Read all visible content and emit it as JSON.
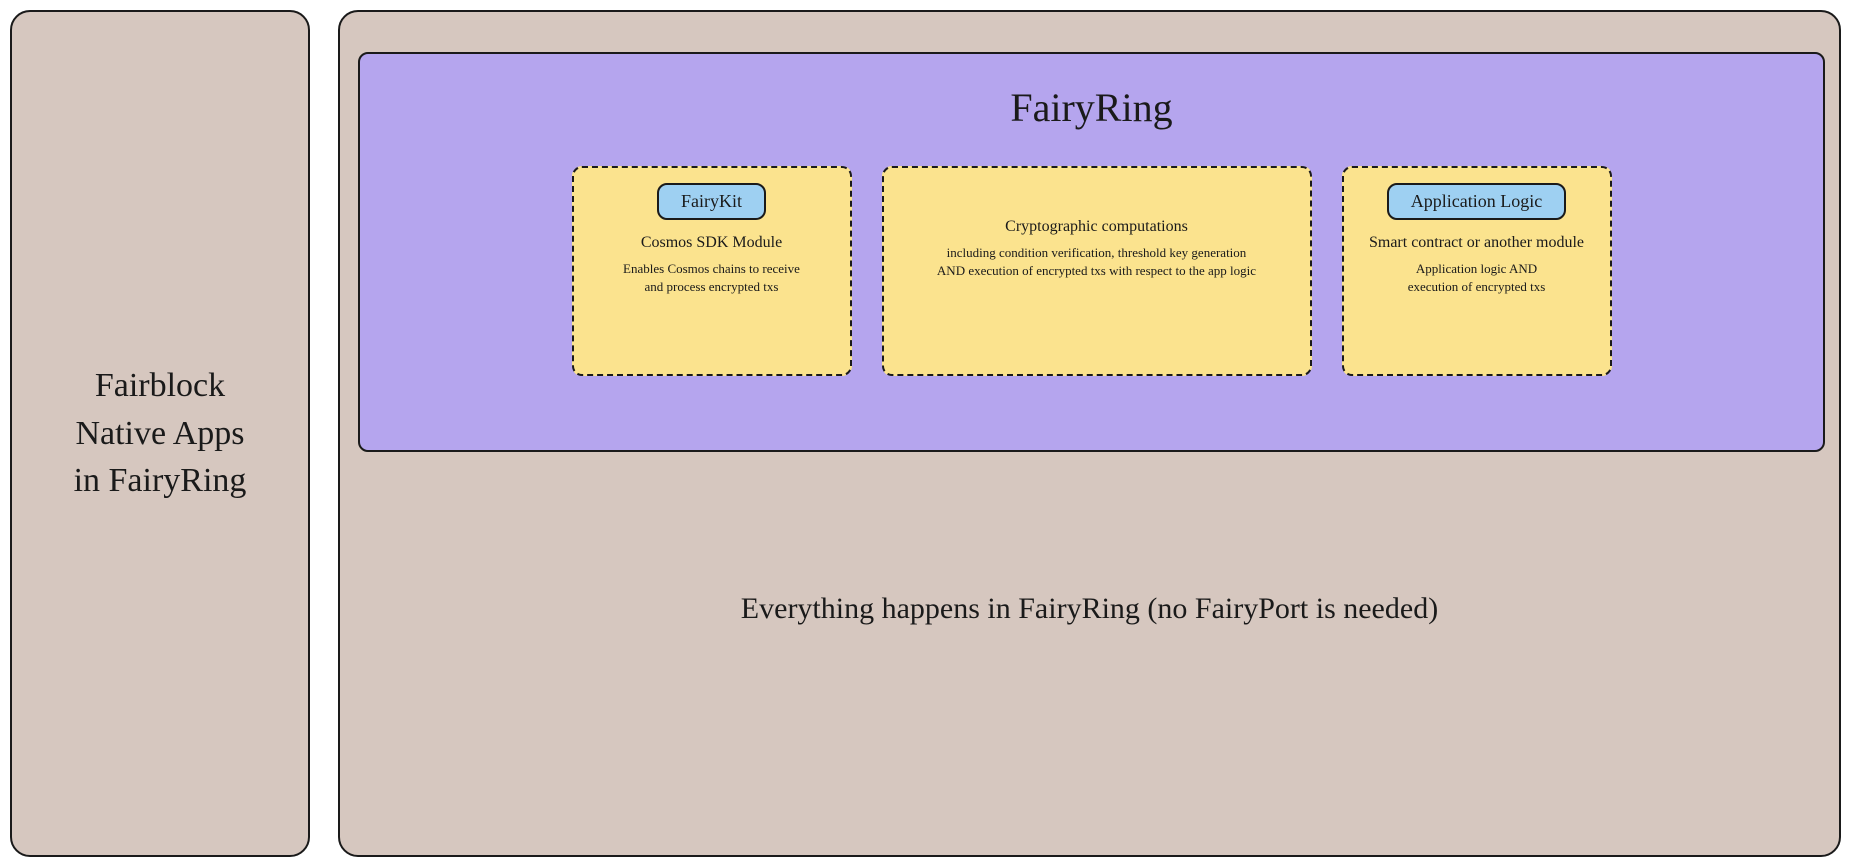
{
  "left": {
    "title": "Fairblock\nNative Apps\nin FairyRing"
  },
  "fairyring": {
    "title": "FairyRing",
    "boxes": {
      "fairykit": {
        "chip": "FairyKit",
        "subtitle": "Cosmos SDK Module",
        "desc": "Enables Cosmos chains to receive\nand process encrypted txs"
      },
      "crypto": {
        "subtitle": "Cryptographic computations",
        "desc": "including condition verification, threshold key generation\nAND execution of encrypted txs with respect to the app logic"
      },
      "applogic": {
        "chip": "Application Logic",
        "subtitle": "Smart contract or another module",
        "desc": "Application logic AND\nexecution of encrypted txs"
      }
    }
  },
  "bottom": {
    "text": "Everything happens in FairyRing (no FairyPort is needed)"
  }
}
